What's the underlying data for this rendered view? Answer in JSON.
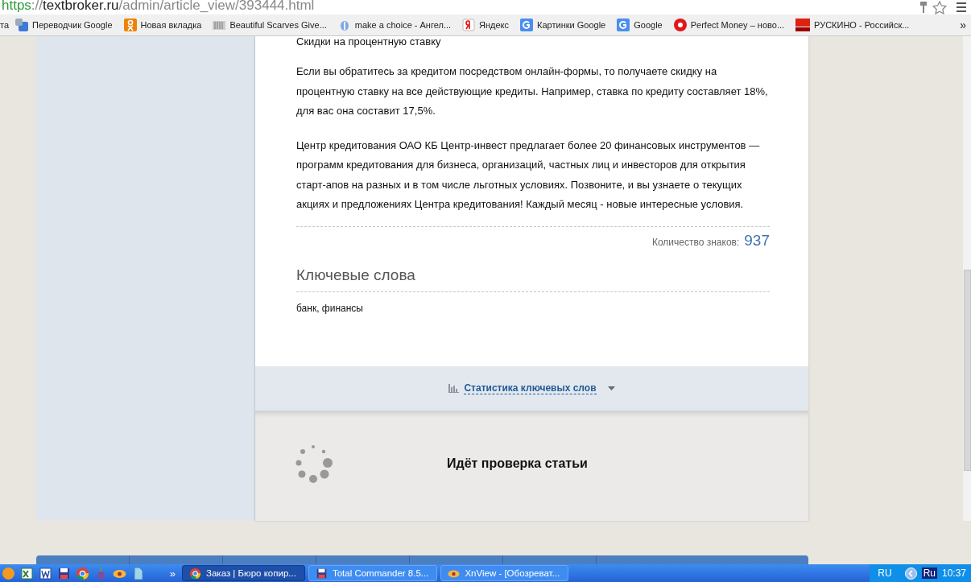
{
  "address_bar": {
    "url": [
      {
        "text": "https",
        "kind": "scheme"
      },
      {
        "text": "://",
        "kind": "muted"
      },
      {
        "text": "textbroker.ru",
        "kind": "host"
      },
      {
        "text": "/admin/article_view/393444.html",
        "kind": "muted"
      }
    ]
  },
  "bookmarks": [
    {
      "label": "та",
      "kind": "none"
    },
    {
      "label": "Переводчик Google",
      "kind": "translate"
    },
    {
      "label": "Новая вкладка",
      "kind": "ok"
    },
    {
      "label": "Beautiful Scarves Give...",
      "kind": "scarves"
    },
    {
      "label": "make a choice - Ангел...",
      "kind": "drop"
    },
    {
      "label": "Яндекс",
      "kind": "yandex"
    },
    {
      "label": "Картинки Google",
      "kind": "google"
    },
    {
      "label": "Google",
      "kind": "google"
    },
    {
      "label": "Perfect Money – ново...",
      "kind": "pm"
    },
    {
      "label": "РУСКИНО - Российск...",
      "kind": "rus"
    }
  ],
  "bookmarks_more": "»",
  "article": {
    "heading": "Скидки на процентную ставку",
    "paragraphs": [
      "Если вы обратитесь за кредитом посредством онлайн-формы, то получаете скидку на процентную ставку на все действующие кредиты. Например, ставка по кредиту составляет 18%, для вас она составит 17,5%.",
      "Центр кредитования ОАО КБ Центр-инвест предлагает более 20 финансовых инструментов — программ кредитования для бизнеса, организаций, частных лиц и инвесторов для открытия старт-апов на разных и в том числе льготных условиях. Позвоните, и вы узнаете о текущих акциях и предложениях Центра кредитования! Каждый месяц - новые интересные условия."
    ],
    "char_count": {
      "label": "Количество знаков:",
      "value": "937"
    },
    "keywords": {
      "title": "Ключевые слова",
      "text": "банк, финансы"
    }
  },
  "stats_toggle": {
    "label": "Статистика ключевых слов",
    "expanded": false
  },
  "check_status": {
    "text": "Идёт проверка статьи"
  },
  "taskbar": {
    "quick_launch": [
      {
        "kind": "ball"
      },
      {
        "kind": "excel"
      },
      {
        "kind": "word"
      },
      {
        "kind": "floppy"
      },
      {
        "kind": "chrome"
      },
      {
        "kind": "onion"
      },
      {
        "kind": "xnview"
      },
      {
        "kind": "file"
      }
    ],
    "overflow": "»",
    "tasks": [
      {
        "label": "Заказ | Бюро копир...",
        "kind": "chrome",
        "selected": true
      },
      {
        "label": "Total Commander 8.5...",
        "kind": "floppy",
        "selected": false
      },
      {
        "label": "XnView - [Обозреват...",
        "kind": "xnview",
        "selected": false
      }
    ],
    "tray": {
      "language": "RU",
      "input": "Ru",
      "clock": "10:37"
    }
  }
}
